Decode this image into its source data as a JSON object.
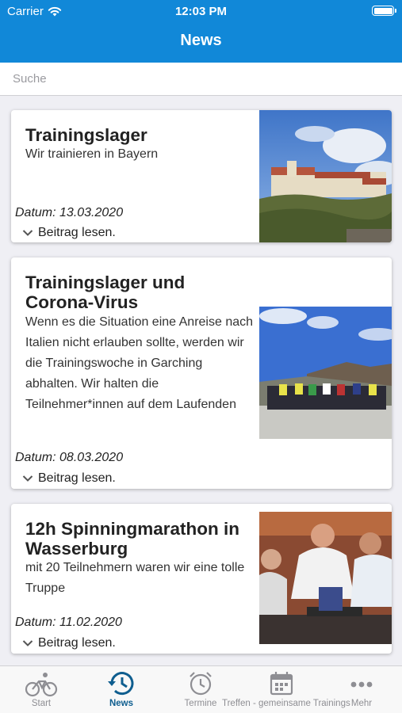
{
  "status_bar": {
    "carrier": "Carrier",
    "time": "12:03 PM"
  },
  "header": {
    "title": "News"
  },
  "search": {
    "placeholder": "Suche"
  },
  "articles": [
    {
      "title": "Trainingslager",
      "text": "Wir trainieren in Bayern",
      "date": "Datum: 13.03.2020",
      "read_label": "Beitrag lesen."
    },
    {
      "title": "Trainingslager und Corona-Virus",
      "text": "Wenn es die Situation eine Anreise nach Italien nicht erlauben sollte, werden wir die Trainingswoche in Garching abhalten. Wir halten die Teilnehmer*innen auf dem Laufenden",
      "date": "Datum: 08.03.2020",
      "read_label": "Beitrag lesen."
    },
    {
      "title": "12h Spinningmarathon in Wasserburg",
      "text": "mit 20 Teilnehmern waren wir eine tolle Truppe",
      "date": "Datum: 11.02.2020",
      "read_label": "Beitrag lesen."
    }
  ],
  "tabs": [
    {
      "label": "Start",
      "icon": "bicycle-icon"
    },
    {
      "label": "News",
      "icon": "history-icon",
      "active": true
    },
    {
      "label": "Termine",
      "icon": "alarm-clock-icon"
    },
    {
      "label": "Treffen - gemeinsame Trainings",
      "icon": "calendar-icon"
    },
    {
      "label": "Mehr",
      "icon": "more-icon"
    }
  ],
  "colors": {
    "header": "#1188d8",
    "tab_active": "#0f5e8f",
    "tab_inactive": "#8e8e93"
  }
}
